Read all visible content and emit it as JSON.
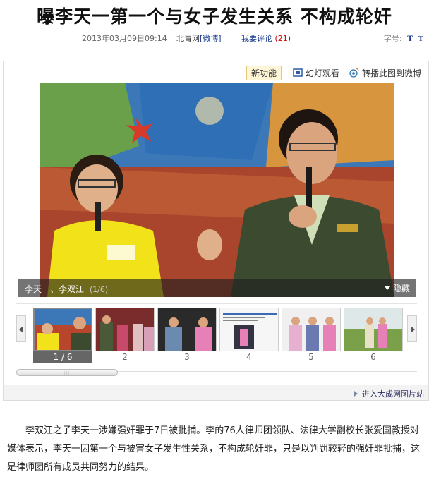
{
  "article_title": "曝李天一第一个与女子发生关系 不构成轮奸",
  "meta": {
    "datetime": "2013年03月09日09:14",
    "source": "北青网",
    "source_link": "[微博]",
    "comment_label": "我要评论",
    "comment_count": "(21)",
    "fontsize_label": "字号:",
    "fontsize_large": "T",
    "fontsize_small": "T"
  },
  "gallery": {
    "new_feature": "新功能",
    "slideshow": "幻灯观看",
    "share_weibo": "转播此图到微博",
    "caption": "李天一、李双江",
    "counter": "(1/6)",
    "hide_label": "隐藏",
    "thumbnails": [
      {
        "label": "1 / 6",
        "active": true
      },
      {
        "label": "2",
        "active": false
      },
      {
        "label": "3",
        "active": false
      },
      {
        "label": "4",
        "active": false
      },
      {
        "label": "5",
        "active": false
      },
      {
        "label": "6",
        "active": false
      }
    ],
    "enter_gallery": "进入大成网图片站"
  },
  "article_body": "李双江之子李天一涉嫌强奸罪于7日被批捕。李的76人律师团领队、法律大学副校长张爱国教授对媒体表示，李天一因第一个与被害女子发生性关系，不构成轮奸罪，只是以判罚较轻的强奸罪批捕，这是律师团所有成员共同努力的结果。",
  "colors": {
    "link": "#1a3d8f",
    "count": "#cc0000",
    "new_feature_bg": "#fff6d8"
  }
}
